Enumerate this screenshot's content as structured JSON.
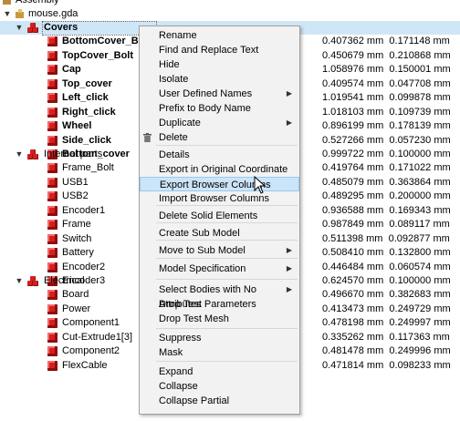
{
  "tree": {
    "root_label": "Assembly",
    "file_label": "mouse.gda",
    "groups": [
      {
        "label": "Covers",
        "items": [
          {
            "label": "BottomCover_Bolt",
            "v1": "0.407362 mm",
            "v2": "0.171148 mm"
          },
          {
            "label": "TopCover_Bolt",
            "v1": "0.450679 mm",
            "v2": "0.210868 mm"
          },
          {
            "label": "Cap",
            "v1": "1.058976 mm",
            "v2": "0.150001 mm"
          },
          {
            "label": "Top_cover",
            "v1": "0.409574 mm",
            "v2": "0.047708 mm"
          },
          {
            "label": "Left_click",
            "v1": "1.019541 mm",
            "v2": "0.099878 mm"
          },
          {
            "label": "Right_click",
            "v1": "1.018103 mm",
            "v2": "0.109739 mm"
          },
          {
            "label": "Wheel",
            "v1": "0.896199 mm",
            "v2": "0.178139 mm"
          },
          {
            "label": "Side_click",
            "v1": "0.527266 mm",
            "v2": "0.057230 mm"
          },
          {
            "label": "Bottom_cover",
            "v1": "0.999722 mm",
            "v2": "0.100000 mm"
          }
        ]
      },
      {
        "label": "Internal parts",
        "items": [
          {
            "label": "Frame_Bolt",
            "v1": "0.419764 mm",
            "v2": "0.171022 mm"
          },
          {
            "label": "USB1",
            "v1": "0.485079 mm",
            "v2": "0.363864 mm"
          },
          {
            "label": "USB2",
            "v1": "0.489295 mm",
            "v2": "0.200000 mm"
          },
          {
            "label": "Encoder1",
            "v1": "0.936588 mm",
            "v2": "0.169343 mm"
          },
          {
            "label": "Frame",
            "v1": "0.987849 mm",
            "v2": "0.089117 mm"
          },
          {
            "label": "Switch",
            "v1": "0.511398 mm",
            "v2": "0.092877 mm"
          },
          {
            "label": "Battery",
            "v1": "0.508410 mm",
            "v2": "0.132800 mm"
          },
          {
            "label": "Encoder2",
            "v1": "0.446484 mm",
            "v2": "0.060574 mm"
          },
          {
            "label": "Encoder3",
            "v1": "0.624570 mm",
            "v2": "0.100000 mm"
          }
        ]
      },
      {
        "label": "Electrical",
        "items": [
          {
            "label": "Board",
            "v1": "0.496670 mm",
            "v2": "0.382683 mm"
          },
          {
            "label": "Power",
            "v1": "0.413473 mm",
            "v2": "0.249729 mm"
          },
          {
            "label": "Component1",
            "v1": "0.478198 mm",
            "v2": "0.249997 mm"
          },
          {
            "label": "Cut-Extrude1[3]",
            "v1": "0.335262 mm",
            "v2": "0.117363 mm"
          },
          {
            "label": "Component2",
            "v1": "0.481478 mm",
            "v2": "0.249996 mm"
          },
          {
            "label": "FlexCable",
            "v1": "0.471814 mm",
            "v2": "0.098233 mm"
          }
        ]
      }
    ]
  },
  "menu": {
    "items": [
      {
        "label": "Rename"
      },
      {
        "label": "Find and Replace Text"
      },
      {
        "label": "Hide"
      },
      {
        "label": "Isolate"
      },
      {
        "label": "User Defined Names",
        "submenu": true
      },
      {
        "label": "Prefix to Body Name"
      },
      {
        "label": "Duplicate",
        "submenu": true
      },
      {
        "label": "Delete",
        "icon": "trash-icon"
      },
      {
        "label": "Details"
      },
      {
        "label": "Export in Original Coordinate"
      },
      {
        "label": "Export Browser Columns",
        "hovered": true
      },
      {
        "label": "Import Browser Columns"
      },
      {
        "label": "Delete Solid Elements"
      },
      {
        "label": "Create Sub Model"
      },
      {
        "label": "Move to Sub Model",
        "submenu": true
      },
      {
        "label": "Model Specification",
        "submenu": true
      },
      {
        "label": "Select Bodies with No Attributes",
        "submenu": true
      },
      {
        "label": "Drop Test Parameters"
      },
      {
        "label": "Drop Test Mesh"
      },
      {
        "label": "Suppress"
      },
      {
        "label": "Mask"
      },
      {
        "label": "Expand"
      },
      {
        "label": "Collapse"
      },
      {
        "label": "Collapse Partial"
      }
    ]
  },
  "colors": {
    "selection": "#cfe6f7",
    "menu_hover": "#cce4f7",
    "part_red": "#d51f1f"
  }
}
